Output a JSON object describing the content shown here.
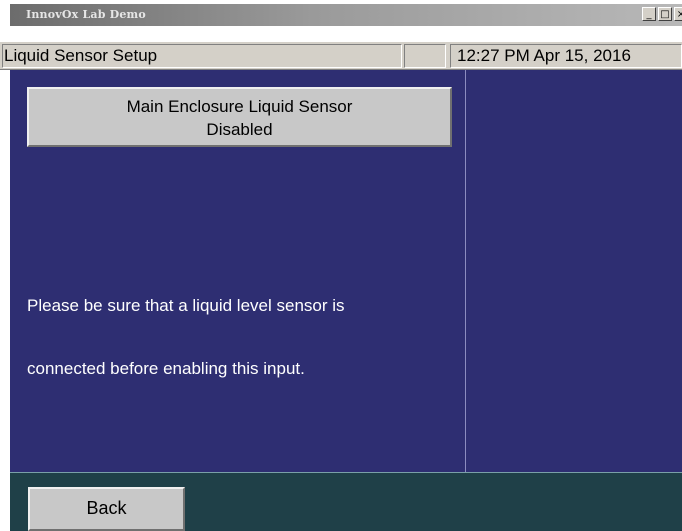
{
  "window": {
    "title": "InnovOx Lab Demo",
    "minimize_label": "_",
    "maximize_label": "□",
    "close_label": "×"
  },
  "header": {
    "screen_title": "Liquid Sensor Setup",
    "status_cell": "",
    "datetime": "12:27 PM Apr 15, 2016"
  },
  "main": {
    "sensor_button": {
      "line1": "Main Enclosure Liquid Sensor",
      "line2": "Disabled"
    },
    "message_line1": "Please be sure that a liquid level sensor is",
    "message_line2": "connected before enabling this input."
  },
  "footer": {
    "back_label": "Back"
  },
  "colors": {
    "main_background": "#2e2e72",
    "footer_background": "#1f4048",
    "button_face": "#c8c8c8",
    "header_face": "#d4d0c8"
  }
}
